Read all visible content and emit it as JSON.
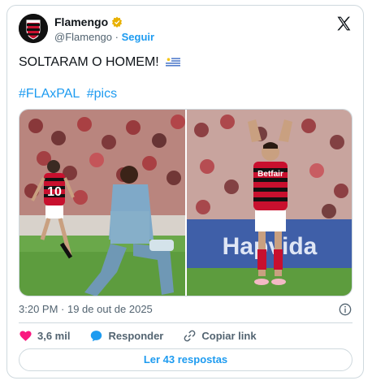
{
  "author": {
    "name": "Flamengo",
    "handle": "@Flamengo",
    "separator": "·",
    "follow_label": "Seguir"
  },
  "tweet": {
    "text": "SOLTARAM O HOMEM!",
    "hashtags": [
      "#FLAxPAL",
      "#pics"
    ],
    "timestamp": "3:20 PM · 19 de out de 2025"
  },
  "photo2": {
    "sponsor": "Betfair",
    "board_text": "Hapvida"
  },
  "actions": {
    "likes": "3,6 mil",
    "reply_label": "Responder",
    "copy_label": "Copiar link"
  },
  "read_replies_label": "Ler 43 respostas",
  "colors": {
    "accent": "#1d9bf0",
    "like": "#f91880",
    "verified": "#e8b100",
    "text_secondary": "#536471",
    "border": "#cfd9de"
  }
}
